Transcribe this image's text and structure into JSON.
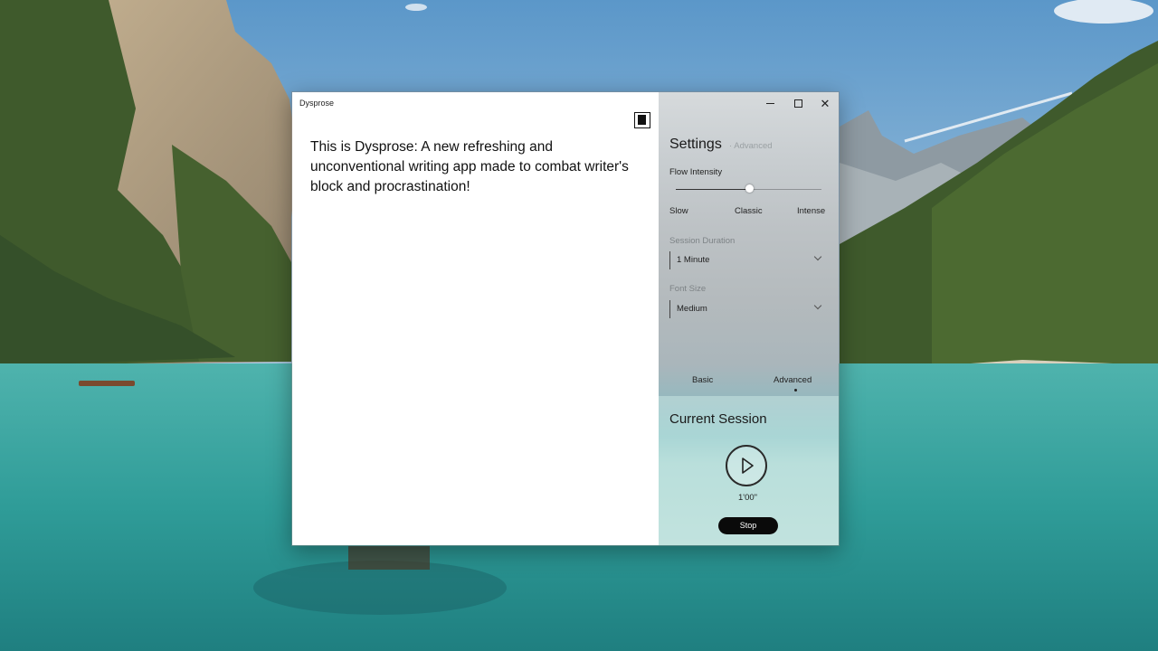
{
  "window": {
    "title": "Dysprose"
  },
  "editor": {
    "text": "This is Dysprose: A new refreshing and unconventional writing app made to combat writer's block and procrastination!",
    "theme_toggle_icon": "contrast-square-icon"
  },
  "settings": {
    "title": "Settings",
    "advanced_link": "· Advanced",
    "flow_intensity": {
      "label": "Flow Intensity",
      "value_fraction": 0.5,
      "ticks": [
        "Slow",
        "Classic",
        "Intense"
      ]
    },
    "session_duration": {
      "label": "Session Duration",
      "selected": "1 Minute"
    },
    "font_size": {
      "label": "Font Size",
      "selected": "Medium"
    },
    "tabs": [
      "Basic",
      "Advanced"
    ],
    "active_tab": "Advanced"
  },
  "session": {
    "title": "Current Session",
    "time": "1'00\"",
    "stop_label": "Stop"
  },
  "colors": {
    "editor_background": "#ffffff",
    "stop_button": "#0a0a0a",
    "lake_teal": "#3ea7a3"
  }
}
